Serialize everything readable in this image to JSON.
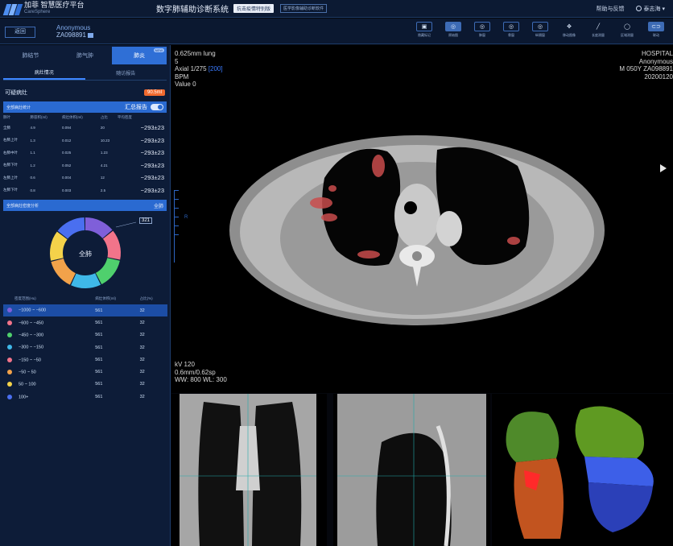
{
  "header": {
    "brand": "加菲 智慧医疗平台",
    "brand_sub": "CareSphere",
    "brand_caption": "数泽科技",
    "app_title": "数字肺辅助诊断系统",
    "special_tag": "抗击疫情特别版",
    "outline_tag": "医学影像辅助诊断软件",
    "help": "帮助与反馈",
    "user": "泰志海"
  },
  "patient": {
    "back": "返回",
    "name": "Anonymous",
    "id": "ZA098891"
  },
  "toolbar": [
    "隐藏标记",
    "原始图",
    "肺窗",
    "骨窗",
    "纵隔窗",
    "移动图像",
    "长度测量",
    "区域测量",
    "联动"
  ],
  "left": {
    "tabs": [
      "肺结节",
      "肺气肿",
      "肺炎"
    ],
    "new_badge": "NEW",
    "subtabs": [
      "病灶情况",
      "随访报告"
    ],
    "suspected_label": "可疑病灶",
    "suspected_value": "90.5ml",
    "stats_section": "全部病灶统计",
    "summary_toggle": "汇总报告",
    "stats_headers": [
      "肺叶",
      "肺容积(ml)",
      "病灶体积(ml)",
      "占比",
      "平均密度"
    ],
    "stats_rows": [
      [
        "全肺",
        "4.9",
        "0.094",
        "20",
        "−293±23"
      ],
      [
        "右肺上叶",
        "1.3",
        "0.012",
        "10.23",
        "−293±23"
      ],
      [
        "右肺中叶",
        "1.1",
        "0.025",
        "1.23",
        "−293±23"
      ],
      [
        "右肺下叶",
        "1.2",
        "0.052",
        "4.21",
        "−293±23"
      ],
      [
        "左肺上叶",
        "0.6",
        "0.004",
        "12",
        "−293±23"
      ],
      [
        "左肺下叶",
        "0.8",
        "0.003",
        "2.5",
        "−293±23"
      ]
    ],
    "density_section": "全部病灶密度分析",
    "density_scope": "全肺",
    "pie_center": "全肺",
    "pie_callout": "321",
    "pie_colors": [
      "#7f5fd9",
      "#f2748a",
      "#4fd06d",
      "#3fb8e8",
      "#f2a24a",
      "#f4d24a",
      "#4a6ff0"
    ],
    "density_headers": [
      "密度范围(Hu)",
      "病灶体积(ml)",
      "占比(%)"
    ],
    "density_rows": [
      {
        "range": "−1000 ~ −600",
        "vol": "561",
        "pct": "32",
        "color": "#7f5fd9"
      },
      {
        "range": "−600 ~ −450",
        "vol": "561",
        "pct": "32",
        "color": "#f2748a"
      },
      {
        "range": "−450 ~ −300",
        "vol": "561",
        "pct": "32",
        "color": "#4fd06d"
      },
      {
        "range": "−300 ~ −150",
        "vol": "561",
        "pct": "32",
        "color": "#3fb8e8"
      },
      {
        "range": "−150 ~ −50",
        "vol": "561",
        "pct": "32",
        "color": "#f2748a"
      },
      {
        "range": "−50 ~ 50",
        "vol": "561",
        "pct": "32",
        "color": "#f2a24a"
      },
      {
        "range": "50 ~ 100",
        "vol": "561",
        "pct": "32",
        "color": "#f4d24a"
      },
      {
        "range": "100+",
        "vol": "561",
        "pct": "32",
        "color": "#4a6ff0"
      }
    ]
  },
  "viewer": {
    "top_left": [
      "0.625mm lung",
      "5",
      "BPM",
      "Value 0"
    ],
    "axial_prefix": "Axial  1/275 ",
    "axial_sel": "[200]",
    "top_right": [
      "HOSPITAL",
      "Anonymous",
      "M  050Y  ZA098891",
      "20200120"
    ],
    "bottom_left": [
      "kV 120",
      "0.6mm/0.62sp",
      "WW: 800 WL: 300"
    ],
    "orient": "R"
  }
}
